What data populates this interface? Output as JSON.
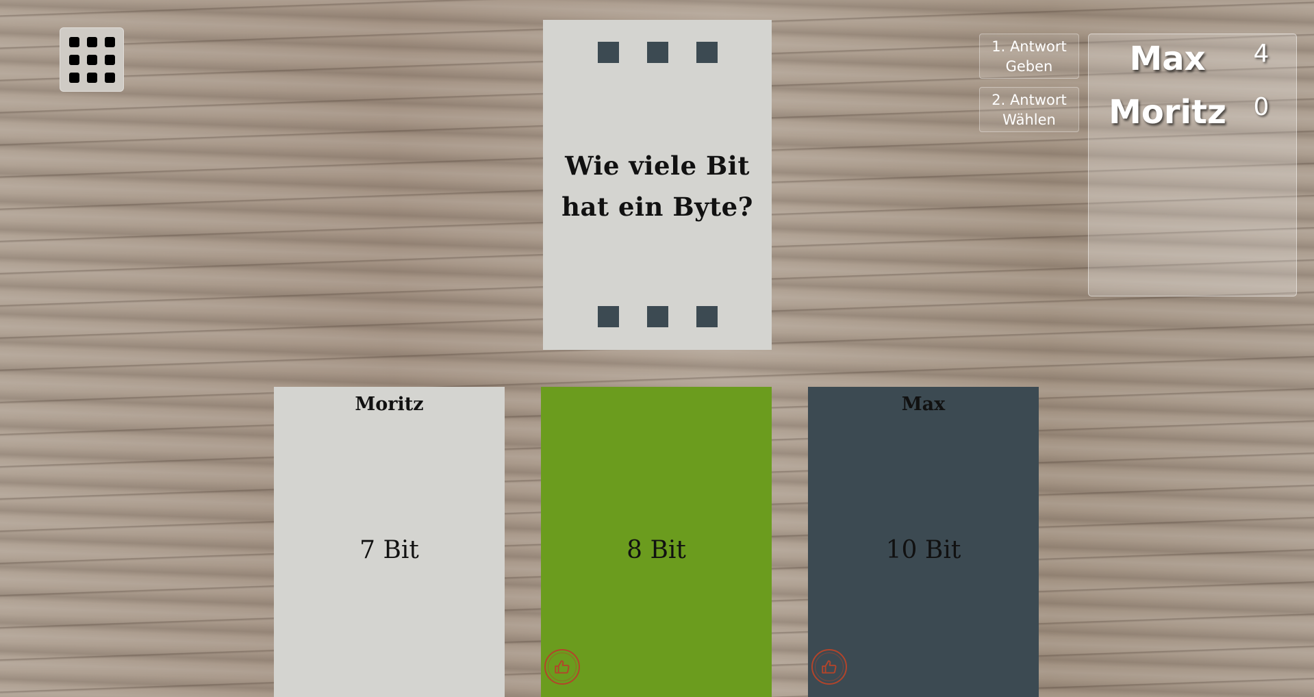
{
  "menu": {
    "icon": "grid-icon"
  },
  "question": {
    "line1": "Wie viele Bit",
    "line2": "hat ein Byte?"
  },
  "answers": [
    {
      "owner": "Moritz",
      "text": "7 Bit",
      "color": "#d4d4d0"
    },
    {
      "owner": "",
      "text": "8 Bit",
      "color": "#6b9c1e",
      "vote_icon": "thumbs-up-icon"
    },
    {
      "owner": "Max",
      "text": "10 Bit",
      "color": "#3c4a52",
      "vote_icon": "thumbs-up-icon"
    }
  ],
  "phases": [
    {
      "line1": "1. Antwort",
      "line2": "Geben"
    },
    {
      "line1": "2. Antwort",
      "line2": "Wählen"
    }
  ],
  "scoreboard": [
    {
      "name": "Max",
      "score": "4"
    },
    {
      "name": "Moritz",
      "score": "0"
    }
  ],
  "colors": {
    "card_light": "#d4d4d0",
    "card_green": "#6b9c1e",
    "card_dark": "#3c4a52",
    "accent_red": "#b3442a"
  }
}
